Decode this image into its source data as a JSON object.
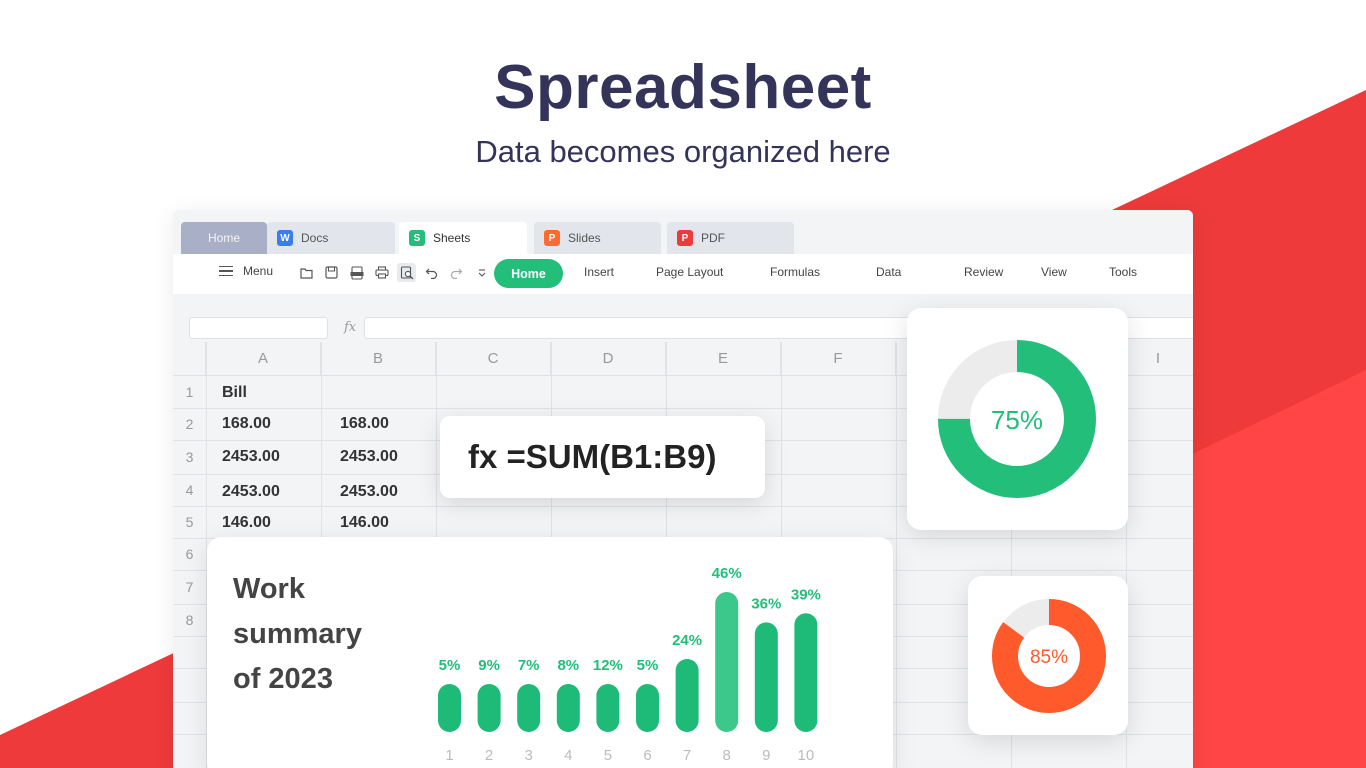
{
  "hero": {
    "title": "Spreadsheet",
    "subtitle": "Data becomes organized here"
  },
  "colors": {
    "brand_dark": "#34345a",
    "green": "#22be7a",
    "orange": "#ff5a2b",
    "red": "#ee3a3a"
  },
  "tabs": [
    {
      "label": "Home",
      "icon": null
    },
    {
      "label": "Docs",
      "icon": "docs-icon",
      "letter": "W"
    },
    {
      "label": "Sheets",
      "icon": "sheets-icon",
      "letter": "S"
    },
    {
      "label": "Slides",
      "icon": "slides-icon",
      "letter": "P"
    },
    {
      "label": "PDF",
      "icon": "pdf-icon",
      "letter": "P"
    }
  ],
  "toolbar": {
    "menu_label": "Menu",
    "icons": [
      "open-folder-icon",
      "save-icon",
      "export-pdf-icon",
      "print-icon",
      "print-preview-icon",
      "undo-icon",
      "redo-icon",
      "more-dropdown-icon"
    ],
    "ribbon": [
      "Home",
      "Insert",
      "Page Layout",
      "Formulas",
      "Data",
      "Review",
      "View",
      "Tools"
    ],
    "active_ribbon": "Home"
  },
  "formula_bar": {
    "fx_label": "fx",
    "namebox_value": "",
    "formula_value": ""
  },
  "sheet": {
    "columns": [
      "A",
      "B",
      "C",
      "D",
      "E",
      "F",
      "I"
    ],
    "rows": [
      "1",
      "2",
      "3",
      "4",
      "5",
      "6",
      "7",
      "8"
    ],
    "cells": {
      "A1": "Bill",
      "A2": "168.00",
      "B2": "168.00",
      "A3": "2453.00",
      "B3": "2453.00",
      "A4": "2453.00",
      "B4": "2453.00",
      "A5": "146.00",
      "B5": "146.00"
    }
  },
  "formula_card": {
    "text": "fx =SUM(B1:B9)"
  },
  "donuts": [
    {
      "label": "75%",
      "value": 0.75,
      "color": "#22be7a"
    },
    {
      "label": "85%",
      "value": 0.85,
      "color": "#ff5a2b"
    }
  ],
  "summary": {
    "title_lines": [
      "Work",
      "summary",
      "of 2023"
    ]
  },
  "chart_data": {
    "type": "bar",
    "categories": [
      "1",
      "2",
      "3",
      "4",
      "5",
      "6",
      "7",
      "8",
      "9",
      "10"
    ],
    "values": [
      5,
      9,
      7,
      8,
      12,
      5,
      24,
      46,
      36,
      39
    ],
    "value_labels": [
      "5%",
      "9%",
      "7%",
      "8%",
      "12%",
      "5%",
      "24%",
      "46%",
      "36%",
      "39%"
    ],
    "title": "",
    "xlabel": "",
    "ylabel": "",
    "grid": false,
    "highlight_index": 7
  }
}
